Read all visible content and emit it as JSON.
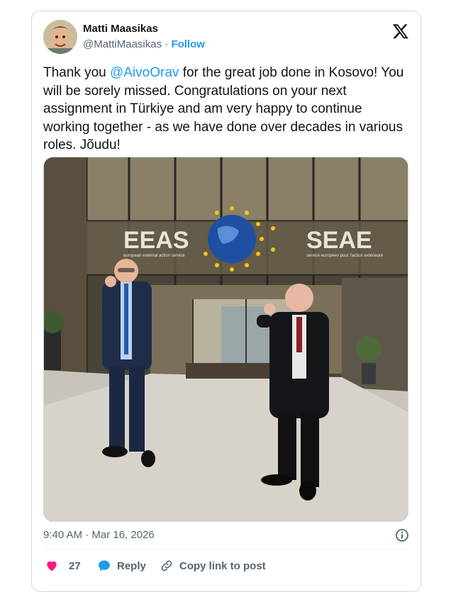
{
  "author": {
    "display_name": "Matti Maasikas",
    "handle": "@MattiMaasikas",
    "separator": "·",
    "follow_label": "Follow"
  },
  "tweet": {
    "text_before_mention": "Thank you ",
    "mention": "@AivoOrav",
    "text_after_mention": " for the great job done in Kosovo! You will be sorely missed. Congratulations on your next assignment in Türkiye and am very happy to continue working together - as we have done over decades in various roles. Jõudu!"
  },
  "media": {
    "sign_left": "EEAS",
    "sign_left_sub": "european external action service",
    "sign_right": "SEAE",
    "sign_right_sub": "service européen pour l'action extérieure"
  },
  "meta": {
    "timestamp": "9:40 AM · Mar 16, 2026"
  },
  "actions": {
    "like_count": "27",
    "reply_label": "Reply",
    "copy_label": "Copy link to post"
  },
  "colors": {
    "link": "#1d9bf0",
    "like": "#f91880",
    "muted": "#536471",
    "border": "#cfd9de"
  },
  "icons": {
    "brand": "x-logo-icon",
    "info": "info-icon",
    "like": "heart-icon",
    "reply": "speech-bubble-icon",
    "copy": "link-icon"
  }
}
